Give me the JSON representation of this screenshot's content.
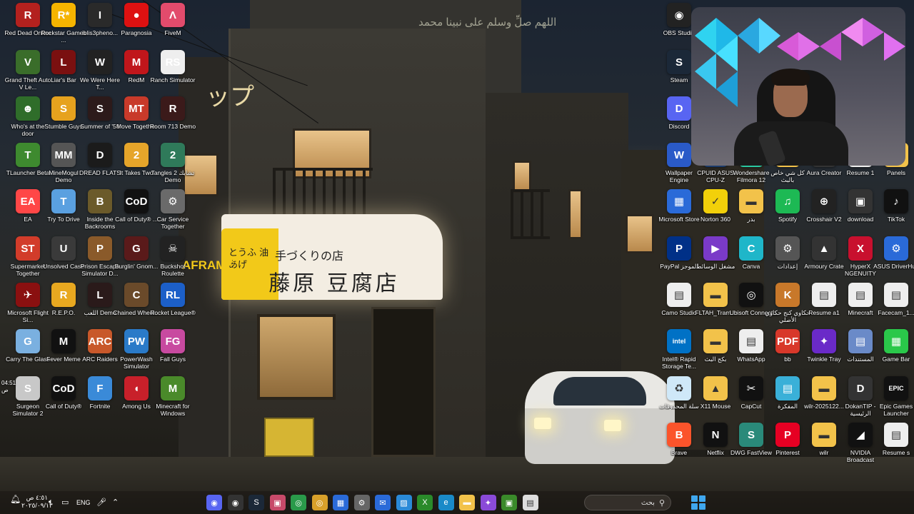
{
  "wallpaper": {
    "prayer_text": "اللهم صلِّ وسلم على نبينا محمد",
    "katakana": "ップ",
    "sign_main": "藤原 豆腐店",
    "sign_top": "手づくりの店",
    "sign_yellow": "とうふ 油あげ",
    "aframe": "AFRAME"
  },
  "desktop_icons": [
    {
      "label": "Red Dead Online",
      "icon": "rdo-icon",
      "color": "#b3211e",
      "glyph": "R"
    },
    {
      "label": "Rockstar Games ...",
      "icon": "rockstar-icon",
      "color": "#f5b400",
      "glyph": "R*"
    },
    {
      "label": "iblis3pheno...",
      "icon": "iblis-icon",
      "color": "#2a2a2a",
      "glyph": "I"
    },
    {
      "label": "Paragnosia",
      "icon": "paragnosia-icon",
      "color": "#d11",
      "glyph": "●"
    },
    {
      "label": "FiveM",
      "icon": "fivem-icon",
      "color": "#e24b6c",
      "glyph": "Λ"
    },
    {
      "label": "Grand Theft Auto V Le...",
      "icon": "gta-icon",
      "color": "#3a6d2a",
      "glyph": "V"
    },
    {
      "label": "Liar's Bar",
      "icon": "liars-bar-icon",
      "color": "#7a1010",
      "glyph": "L"
    },
    {
      "label": "We Were Here T...",
      "icon": "we-were-here-icon",
      "color": "#222",
      "glyph": "W"
    },
    {
      "label": "RedM",
      "icon": "redm-icon",
      "color": "#c0161b",
      "glyph": "M"
    },
    {
      "label": "Ranch Simulator",
      "icon": "ranch-icon",
      "color": "#eee",
      "glyph": "RS"
    },
    {
      "label": "Who's at the door",
      "icon": "whos-door-icon",
      "color": "#2f6d2a",
      "glyph": "☻"
    },
    {
      "label": "Stumble Guys",
      "icon": "stumble-icon",
      "color": "#e6a21e",
      "glyph": "S"
    },
    {
      "label": "Summer of '58",
      "icon": "summer58-icon",
      "color": "#2c1a1a",
      "glyph": "S"
    },
    {
      "label": "Move Together",
      "icon": "move-together-icon",
      "color": "#c83a2a",
      "glyph": "MT"
    },
    {
      "label": "Room 713 Demo",
      "icon": "room713-icon",
      "color": "#3b1a1a",
      "glyph": "R"
    },
    {
      "label": "TLauncher Beta",
      "icon": "tlauncher-icon",
      "color": "#3e8a2f",
      "glyph": "T"
    },
    {
      "label": "MineMogul Demo",
      "icon": "minemogul-icon",
      "color": "#555",
      "glyph": "MM"
    },
    {
      "label": "DREAD FLATS",
      "icon": "dread-flats-icon",
      "color": "#1b1b1b",
      "glyph": "D"
    },
    {
      "label": "It Takes Two",
      "icon": "it-takes-two-icon",
      "color": "#e6a52a",
      "glyph": "2"
    },
    {
      "label": "Tangles 2 تشابك Demo",
      "icon": "tangles-icon",
      "color": "#2f7a5a",
      "glyph": "2"
    },
    {
      "label": "EA",
      "icon": "ea-icon",
      "color": "#ff4747",
      "glyph": "EA"
    },
    {
      "label": "Try To Drive",
      "icon": "try-drive-icon",
      "color": "#5aa0e0",
      "glyph": "T"
    },
    {
      "label": "Inside the Backrooms",
      "icon": "backrooms-icon",
      "color": "#6b5a2a",
      "glyph": "B"
    },
    {
      "label": "Call of Duty® ...",
      "icon": "cod-icon",
      "color": "#111",
      "glyph": "CoD"
    },
    {
      "label": "Car Service Together",
      "icon": "car-service-icon",
      "color": "#6a6a6a",
      "glyph": "⚙"
    },
    {
      "label": "Supermarket Together",
      "icon": "supermarket-icon",
      "color": "#d23c2a",
      "glyph": "ST"
    },
    {
      "label": "Unsolved Case",
      "icon": "unsolved-case-icon",
      "color": "#3a3a3a",
      "glyph": "U"
    },
    {
      "label": "Prison Escape Simulator D...",
      "icon": "prison-escape-icon",
      "color": "#8a5a2a",
      "glyph": "P"
    },
    {
      "label": "Burglin' Gnom...",
      "icon": "burglin-icon",
      "color": "#5a1a1a",
      "glyph": "G"
    },
    {
      "label": "Buckshot Roulette",
      "icon": "buckshot-icon",
      "color": "#222",
      "glyph": "☠"
    },
    {
      "label": "Microsoft Flight Si...",
      "icon": "flight-sim-icon",
      "color": "#8a1010",
      "glyph": "✈"
    },
    {
      "label": "R.E.P.O.",
      "icon": "repo-icon",
      "color": "#e8a820",
      "glyph": "R"
    },
    {
      "label": "اللعب Demo",
      "icon": "arabic-demo-icon",
      "color": "#2a1a1a",
      "glyph": "L"
    },
    {
      "label": "Chained Wheel...",
      "icon": "chained-wheels-icon",
      "color": "#6a4a2a",
      "glyph": "C"
    },
    {
      "label": "Rocket League®",
      "icon": "rocket-league-icon",
      "color": "#1c5fc8",
      "glyph": "RL"
    },
    {
      "label": "Carry The Glass",
      "icon": "carry-glass-icon",
      "color": "#7ab0e0",
      "glyph": "G"
    },
    {
      "label": "Fever Meme",
      "icon": "fever-meme-icon",
      "color": "#111",
      "glyph": "M"
    },
    {
      "label": "ARC Raiders",
      "icon": "arc-raiders-icon",
      "color": "#c8582a",
      "glyph": "ARC"
    },
    {
      "label": "PowerWash Simulator",
      "icon": "powerwash-icon",
      "color": "#2a7ac8",
      "glyph": "PW"
    },
    {
      "label": "Fall Guys",
      "icon": "fall-guys-icon",
      "color": "#c84aa0",
      "glyph": "FG"
    },
    {
      "label": "Surgeon Simulator 2",
      "icon": "surgeon-icon",
      "color": "#c8c8c8",
      "glyph": "S"
    },
    {
      "label": "Call of Duty®",
      "icon": "cod2-icon",
      "color": "#111",
      "glyph": "CoD"
    },
    {
      "label": "Fortnite",
      "icon": "fortnite-icon",
      "color": "#3a8ad8",
      "glyph": "F"
    },
    {
      "label": "Among Us",
      "icon": "among-us-icon",
      "color": "#c8202a",
      "glyph": "◖"
    },
    {
      "label": "Minecraft for Windows",
      "icon": "minecraft-win-icon",
      "color": "#4a8a2a",
      "glyph": "M"
    }
  ],
  "right_icons": [
    {
      "label": "OBS Studio",
      "icon": "obs-icon",
      "color": "#222",
      "glyph": "◉"
    },
    {
      "label": "Steam",
      "icon": "steam-icon",
      "color": "#1b2838",
      "glyph": "S"
    },
    {
      "label": "Discord",
      "icon": "discord-icon",
      "color": "#5865f2",
      "glyph": "D"
    },
    {
      "label": "Wallpaper Engine",
      "icon": "wallpaper-engine-icon",
      "color": "#2a5ac8",
      "glyph": "W"
    },
    {
      "label": "CPUID ASUS CPU-Z",
      "icon": "cpuz-icon",
      "color": "#1a3a6a",
      "glyph": "Z"
    },
    {
      "label": "Wondershare Filmora 12",
      "icon": "filmora-icon",
      "color": "#2ac8a0",
      "glyph": "F"
    },
    {
      "label": "كل شي خاص بالبث",
      "icon": "stream-folder-icon",
      "color": "#f2c24a",
      "glyph": "▬"
    },
    {
      "label": "Aura Creator",
      "icon": "aura-creator-icon",
      "color": "#333",
      "glyph": "A"
    },
    {
      "label": "Resume 1",
      "icon": "resume1-icon",
      "color": "#eee",
      "glyph": "▤"
    },
    {
      "label": "Panels",
      "icon": "panels-icon",
      "color": "#f2c24a",
      "glyph": "▬"
    },
    {
      "label": "Microsoft Store",
      "icon": "ms-store-icon",
      "color": "#2a6ad8",
      "glyph": "▦"
    },
    {
      "label": "Norton 360",
      "icon": "norton-icon",
      "color": "#f2d00a",
      "glyph": "✓"
    },
    {
      "label": "بدر",
      "icon": "badr-folder-icon",
      "color": "#f2c24a",
      "glyph": "▬"
    },
    {
      "label": "Spotify",
      "icon": "spotify-icon",
      "color": "#1db954",
      "glyph": "♫"
    },
    {
      "label": "Crosshair V2",
      "icon": "crosshair-icon",
      "color": "#222",
      "glyph": "⊕"
    },
    {
      "label": "download",
      "icon": "download-icon",
      "color": "#333",
      "glyph": "▣"
    },
    {
      "label": "TikTok",
      "icon": "tiktok-icon",
      "color": "#111",
      "glyph": "♪"
    },
    {
      "label": "PayPal الموجز",
      "icon": "paypal-icon",
      "color": "#003087",
      "glyph": "P"
    },
    {
      "label": "مشغل الوسائط",
      "icon": "media-player-icon",
      "color": "#7a3ac8",
      "glyph": "▶"
    },
    {
      "label": "Canva",
      "icon": "canva-icon",
      "color": "#1fb6c9",
      "glyph": "C"
    },
    {
      "label": "إعدادات",
      "icon": "settings-icon",
      "color": "#555",
      "glyph": "⚙"
    },
    {
      "label": "Armoury Crate",
      "icon": "armoury-crate-icon",
      "color": "#333",
      "glyph": "▲"
    },
    {
      "label": "HyperX NGENUITY",
      "icon": "hyperx-icon",
      "color": "#c8102e",
      "glyph": "X"
    },
    {
      "label": "ASUS DriverHub",
      "icon": "asus-driverhub-icon",
      "color": "#2a6ad8",
      "glyph": "⚙"
    },
    {
      "label": "Camo Studio",
      "icon": "camo-icon",
      "color": "#eee",
      "glyph": "▤"
    },
    {
      "label": "FLTAH_Tram...",
      "icon": "fltah-icon",
      "color": "#f2c24a",
      "glyph": "▬"
    },
    {
      "label": "Ubisoft Connect",
      "icon": "ubisoft-icon",
      "color": "#111",
      "glyph": "◎"
    },
    {
      "label": "حكاوي كنج حكاوي الأصلي",
      "icon": "hakawi-icon",
      "color": "#c8782a",
      "glyph": "K"
    },
    {
      "label": "Resume a1",
      "icon": "resume-a1-icon",
      "color": "#eee",
      "glyph": "▤"
    },
    {
      "label": "Minecraft",
      "icon": "minecraft-file-icon",
      "color": "#eee",
      "glyph": "▤"
    },
    {
      "label": "Facecam_1...",
      "icon": "facecam-icon",
      "color": "#eee",
      "glyph": "▤"
    },
    {
      "label": "Intel® Rapid Storage Te...",
      "icon": "intel-icon",
      "color": "#0071c5",
      "glyph": "intel"
    },
    {
      "label": "بكج البث",
      "icon": "stream-package-icon",
      "color": "#f2c24a",
      "glyph": "▬"
    },
    {
      "label": "WhatsApp",
      "icon": "whatsapp-icon",
      "color": "#eee",
      "glyph": "▤"
    },
    {
      "label": "bb",
      "icon": "pdf-icon",
      "color": "#d8382a",
      "glyph": "PDF"
    },
    {
      "label": "Twinkle Tray",
      "icon": "twinkle-tray-icon",
      "color": "#6a2ac8",
      "glyph": "✦"
    },
    {
      "label": "المستندات",
      "icon": "documents-icon",
      "color": "#6a8ac8",
      "glyph": "▤"
    },
    {
      "label": "Game Bar",
      "icon": "game-bar-icon",
      "color": "#2ac84a",
      "glyph": "▦"
    },
    {
      "label": "سلة المحذوفات",
      "icon": "recycle-bin-icon",
      "color": "#cfe8f8",
      "glyph": "♻"
    },
    {
      "label": "X11 Mouse",
      "icon": "x11-mouse-icon",
      "color": "#f2c24a",
      "glyph": "▲"
    },
    {
      "label": "CapCut",
      "icon": "capcut-icon",
      "color": "#111",
      "glyph": "✂"
    },
    {
      "label": "المفكرة",
      "icon": "notepad-icon",
      "color": "#3ab0d8",
      "glyph": "▤"
    },
    {
      "label": "wilr-2025122...",
      "icon": "wilr-folder-icon",
      "color": "#f2c24a",
      "glyph": "▬"
    },
    {
      "label": "DokanTIP - الرئيسية",
      "icon": "dokantip-icon",
      "color": "#333",
      "glyph": "D"
    },
    {
      "label": "Epic Games Launcher",
      "icon": "epic-icon",
      "color": "#111",
      "glyph": "EPIC"
    },
    {
      "label": "Brave",
      "icon": "brave-icon",
      "color": "#fb542b",
      "glyph": "B"
    },
    {
      "label": "Netflix",
      "icon": "netflix-icon",
      "color": "#111",
      "glyph": "N"
    },
    {
      "label": "DWG FastView",
      "icon": "dwg-icon",
      "color": "#2a8a7a",
      "glyph": "S"
    },
    {
      "label": "Pinterest",
      "icon": "pinterest-icon",
      "color": "#e60023",
      "glyph": "P"
    },
    {
      "label": "wilr",
      "icon": "wilr-icon",
      "color": "#f2c24a",
      "glyph": "▬"
    },
    {
      "label": "NVIDIA Broadcast",
      "icon": "nvidia-broadcast-icon",
      "color": "#111",
      "glyph": "◢"
    },
    {
      "label": "Resume s",
      "icon": "resume-s-icon",
      "color": "#eee",
      "glyph": "▤"
    }
  ],
  "side_clock": {
    "time": "04:51",
    "period": "ص"
  },
  "taskbar": {
    "clock_time": "٤:٥١ ص",
    "clock_date": "٢٠٢٥/٠٩/١٣",
    "language": "ENG",
    "search_placeholder": "بحث",
    "apps": [
      {
        "name": "discord-tb-icon",
        "glyph": "◉",
        "color": "#5865f2"
      },
      {
        "name": "obs-tb-icon",
        "glyph": "◉",
        "color": "#333"
      },
      {
        "name": "steam-tb-icon",
        "glyph": "S",
        "color": "#1b2838"
      },
      {
        "name": "terminal-tb-icon",
        "glyph": "▣",
        "color": "#c84a6a"
      },
      {
        "name": "chrome-tb-icon",
        "glyph": "◎",
        "color": "#2a9a4a"
      },
      {
        "name": "chrome-profile-tb-icon",
        "glyph": "◎",
        "color": "#d8a02a"
      },
      {
        "name": "store-tb-icon",
        "glyph": "▦",
        "color": "#2a6ad8"
      },
      {
        "name": "settings-tb-icon",
        "glyph": "⚙",
        "color": "#666"
      },
      {
        "name": "mail-tb-icon",
        "glyph": "✉",
        "color": "#2a6ad8"
      },
      {
        "name": "photos-tb-icon",
        "glyph": "▨",
        "color": "#2a8ad8"
      },
      {
        "name": "xbox-tb-icon",
        "glyph": "X",
        "color": "#2a8a2a"
      },
      {
        "name": "edge-tb-icon",
        "glyph": "e",
        "color": "#1a8ac8"
      },
      {
        "name": "explorer-tb-icon",
        "glyph": "▬",
        "color": "#f2c24a"
      },
      {
        "name": "copilot-tb-icon",
        "glyph": "✦",
        "color": "#8a4ad8"
      },
      {
        "name": "nvidia-tb-icon",
        "glyph": "▣",
        "color": "#3a8a2a"
      },
      {
        "name": "notepad-tb-icon",
        "glyph": "▤",
        "color": "#ddd"
      }
    ]
  }
}
